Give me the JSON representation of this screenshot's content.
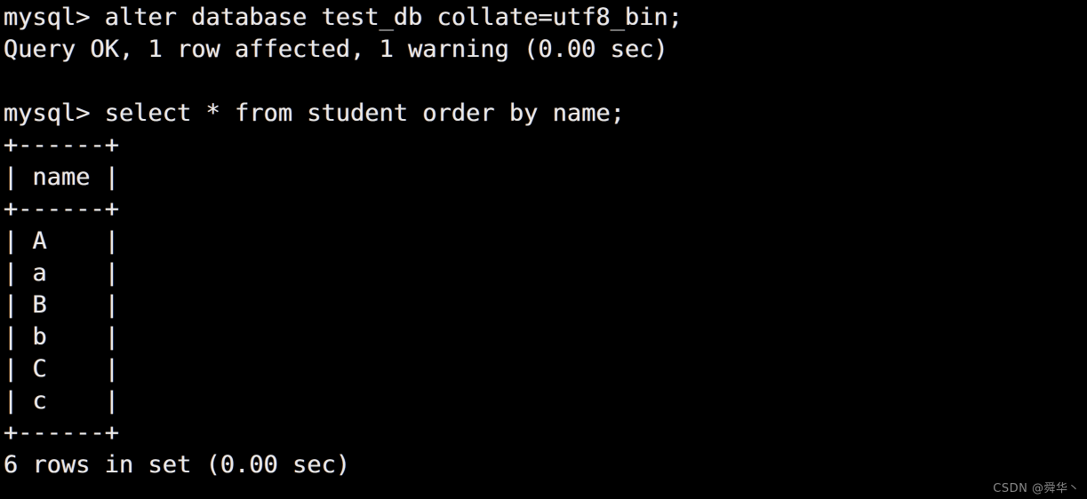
{
  "terminal": {
    "background_color": "#000000",
    "text_color": "#e9e9e9",
    "watermark": "CSDN @舜华丶",
    "lines": [
      {
        "id": "prompt-alter",
        "text": "mysql> alter database test_db collate=utf8_bin;"
      },
      {
        "id": "result-alter",
        "text": "Query OK, 1 row affected, 1 warning (0.00 sec)"
      },
      {
        "id": "blank-1",
        "text": " "
      },
      {
        "id": "prompt-select",
        "text": "mysql> select * from student order by name;"
      },
      {
        "id": "table-top-border",
        "text": "+------+"
      },
      {
        "id": "table-header-row",
        "text": "| name |"
      },
      {
        "id": "table-header-border",
        "text": "+------+"
      },
      {
        "id": "table-row-1",
        "text": "| A    |"
      },
      {
        "id": "table-row-2",
        "text": "| a    |"
      },
      {
        "id": "table-row-3",
        "text": "| B    |"
      },
      {
        "id": "table-row-4",
        "text": "| b    |"
      },
      {
        "id": "table-row-5",
        "text": "| C    |"
      },
      {
        "id": "table-row-6",
        "text": "| c    |"
      },
      {
        "id": "table-bottom-border",
        "text": "+------+"
      },
      {
        "id": "result-select",
        "text": "6 rows in set (0.00 sec)"
      }
    ],
    "commands": [
      {
        "prompt": "mysql>",
        "sql": "alter database test_db collate=utf8_bin;"
      },
      {
        "prompt": "mysql>",
        "sql": "select * from student order by name;"
      }
    ],
    "result_table": {
      "columns": [
        "name"
      ],
      "rows": [
        [
          "A"
        ],
        [
          "a"
        ],
        [
          "B"
        ],
        [
          "b"
        ],
        [
          "C"
        ],
        [
          "c"
        ]
      ],
      "row_count_text": "6 rows in set (0.00 sec)"
    },
    "statuses": [
      "Query OK, 1 row affected, 1 warning (0.00 sec)",
      "6 rows in set (0.00 sec)"
    ]
  }
}
